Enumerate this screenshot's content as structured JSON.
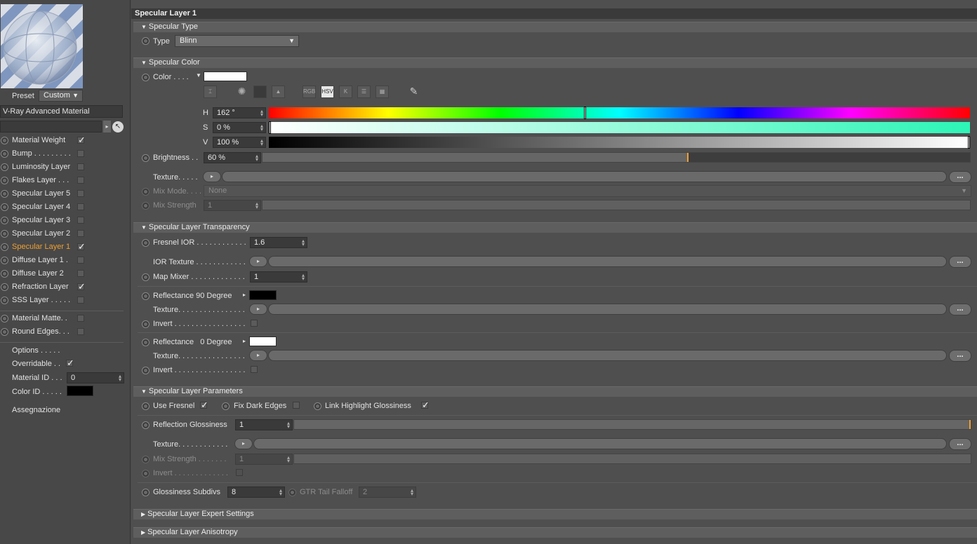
{
  "sidebar": {
    "preset_label": "Preset",
    "preset_value": "Custom",
    "material_name": "V-Ray Advanced Material",
    "layers": [
      {
        "label": "Material Weight",
        "checked": true
      },
      {
        "label": "Bump . . . . . . . . .",
        "checked": false
      },
      {
        "label": "Luminosity Layer",
        "checked": false
      },
      {
        "label": "Flakes Layer . . .",
        "checked": false
      },
      {
        "label": "Specular Layer 5",
        "checked": false
      },
      {
        "label": "Specular Layer 4",
        "checked": false
      },
      {
        "label": "Specular Layer 3",
        "checked": false
      },
      {
        "label": "Specular Layer 2",
        "checked": false
      },
      {
        "label": "Specular Layer 1",
        "checked": true,
        "active": true
      },
      {
        "label": "Diffuse Layer 1 .",
        "checked": false
      },
      {
        "label": "Diffuse Layer 2",
        "checked": false
      },
      {
        "label": "Refraction Layer",
        "checked": true
      },
      {
        "label": "SSS Layer . . . . .",
        "checked": false
      }
    ],
    "extras": [
      {
        "label": "Material Matte. .",
        "checked": false
      },
      {
        "label": "Round Edges. . .",
        "checked": false
      }
    ],
    "options_label": "Options . . . . .",
    "overridable_label": "Overridable . .",
    "material_id_label": "Material ID . . .",
    "material_id_value": "0",
    "color_id_label": "Color ID . . . . .",
    "assign_label": "Assegnazione",
    "active_color": "#f0a030"
  },
  "header": {
    "title": "Specular Layer 1"
  },
  "specular_type": {
    "section": "Specular Type",
    "type_label": "Type",
    "type_value": "Blinn"
  },
  "specular_color": {
    "section": "Specular Color",
    "color_label": "Color . . . .",
    "color_swatch": "#ffffff",
    "tools": [
      "RGB",
      "HSV",
      "K"
    ],
    "h_label": "H",
    "h_value": "162 °",
    "h": 162,
    "s_label": "S",
    "s_value": "0 %",
    "s": 0,
    "v_label": "V",
    "v_value": "100 %",
    "v": 100,
    "brightness_label": "Brightness . .",
    "brightness_value": "60 %",
    "brightness": 60,
    "texture_label": "Texture. . . . .",
    "mix_mode_label": "Mix Mode. . . .",
    "mix_mode_value": "None",
    "mix_strength_label": "Mix Strength",
    "mix_strength_value": "1",
    "dots": "..."
  },
  "transparency": {
    "section": "Specular Layer Transparency",
    "fresnel_label": "Fresnel IOR . . . . . . . . . . . .",
    "fresnel_value": "1.6",
    "ior_texture_label": "IOR Texture . . . . . . . . . . . .",
    "map_mixer_label": "Map Mixer . . . . . . . . . . . . .",
    "map_mixer_value": "1",
    "refl90_label": "Reflectance 90 Degree",
    "refl90_color": "#000000",
    "texture_label": "Texture. . . . . . . . . . . . . . . .",
    "invert_label": "Invert . . . . . . . . . . . . . . . . .",
    "refl0_label": "Reflectance   0 Degree",
    "refl0_color": "#ffffff",
    "texture2_label": "Texture. . . . . . . . . . . . . . . .",
    "invert2_label": "Invert . . . . . . . . . . . . . . . . ."
  },
  "parameters": {
    "section": "Specular Layer Parameters",
    "use_fresnel_label": "Use Fresnel",
    "fix_dark_label": "Fix Dark Edges",
    "link_highlight_label": "Link Highlight Glossiness",
    "refl_gloss_label": "Reflection Glossiness",
    "refl_gloss_value": "1",
    "refl_gloss": 1,
    "texture_label": "Texture. . . . . . . . . . . .",
    "mix_strength_label": "Mix Strength . . . . . . .",
    "mix_strength_value": "1",
    "invert_label": "Invert . . . . . . . . . . . . .",
    "gloss_subdivs_label": "Glossiness Subdivs",
    "gloss_subdivs_value": "8",
    "gtr_label": "GTR Tail Falloff",
    "gtr_value": "2"
  },
  "expert": {
    "section": "Specular Layer Expert Settings"
  },
  "anisotropy": {
    "section": "Specular Layer Anisotropy"
  }
}
